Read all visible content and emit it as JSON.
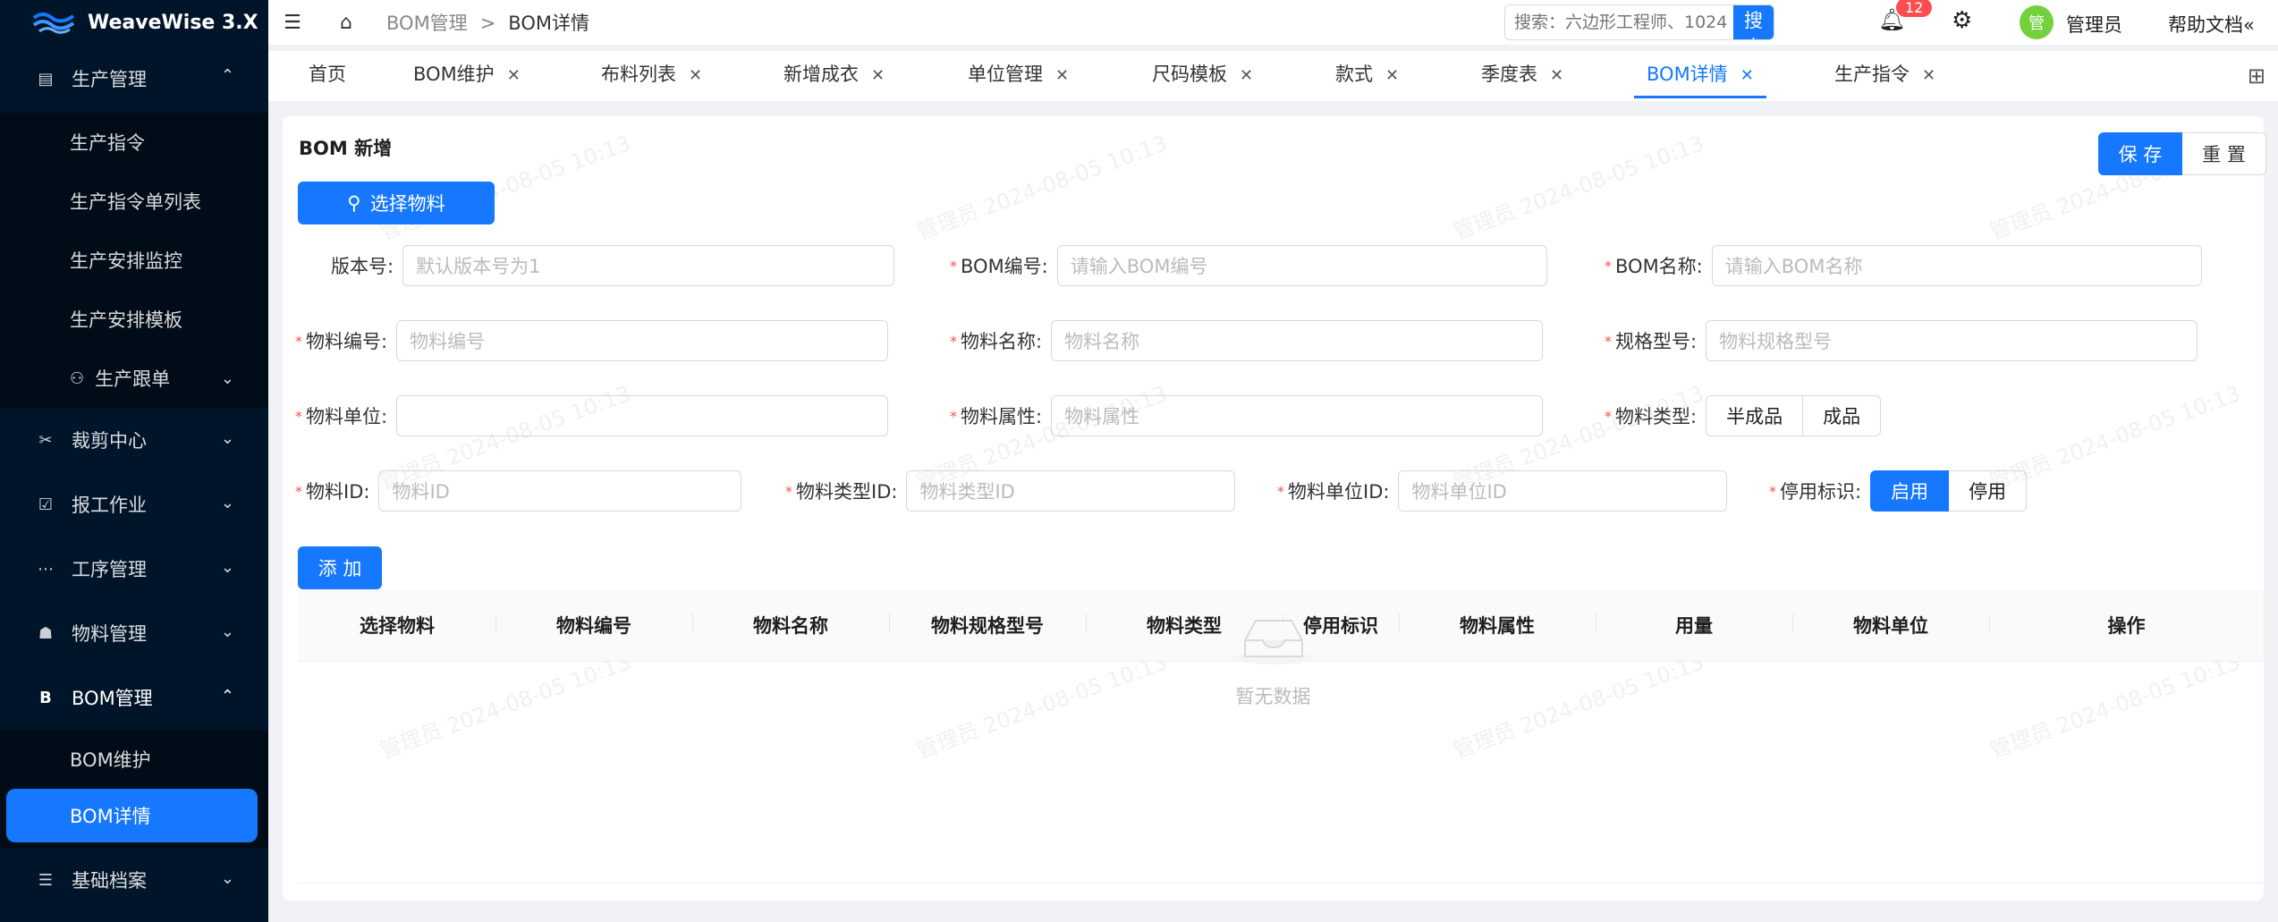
{
  "app": {
    "name": "WeaveWise 3.X"
  },
  "sidebar": {
    "items": [
      {
        "label": "生产管理",
        "icon": "clipboard-icon",
        "expanded": true,
        "children": [
          "生产指令",
          "生产指令单列表",
          "生产安排监控",
          "生产安排模板",
          "生产跟单"
        ]
      },
      {
        "label": "裁剪中心",
        "icon": "scissors-icon"
      },
      {
        "label": "报工作业",
        "icon": "checkbox-icon"
      },
      {
        "label": "工序管理",
        "icon": "dots-icon"
      },
      {
        "label": "物料管理",
        "icon": "hierarchy-icon"
      },
      {
        "label": "BOM管理",
        "icon": "b-letter-icon",
        "expanded": true,
        "children": [
          "BOM维护",
          "BOM详情"
        ]
      },
      {
        "label": "基础档案",
        "icon": "list-icon"
      }
    ],
    "active_child": "BOM详情"
  },
  "header": {
    "breadcrumb": [
      "BOM管理",
      "BOM详情"
    ],
    "breadcrumb_sep": ">",
    "search_placeholder": "搜索：六边形工程师、1024",
    "search_button": "搜 索",
    "notif_count": "12",
    "avatar_text": "管",
    "username": "管理员",
    "help": "帮助文档"
  },
  "tabs": [
    {
      "label": "首页",
      "closable": false
    },
    {
      "label": "BOM维护",
      "closable": true
    },
    {
      "label": "布料列表",
      "closable": true
    },
    {
      "label": "新增成衣",
      "closable": true
    },
    {
      "label": "单位管理",
      "closable": true
    },
    {
      "label": "尺码模板",
      "closable": true
    },
    {
      "label": "款式",
      "closable": true
    },
    {
      "label": "季度表",
      "closable": true
    },
    {
      "label": "BOM详情",
      "closable": true,
      "active": true
    },
    {
      "label": "生产指令",
      "closable": true
    }
  ],
  "form": {
    "title": "BOM 新增",
    "save": "保 存",
    "reset": "重 置",
    "select_material": "选择物料",
    "version": {
      "label": "版本号:",
      "placeholder": "默认版本号为1"
    },
    "bom_code": {
      "label": "BOM编号:",
      "placeholder": "请输入BOM编号"
    },
    "bom_name": {
      "label": "BOM名称:",
      "placeholder": "请输入BOM名称"
    },
    "mat_code": {
      "label": "物料编号:",
      "placeholder": "物料编号"
    },
    "mat_name": {
      "label": "物料名称:",
      "placeholder": "物料名称"
    },
    "spec": {
      "label": "规格型号:",
      "placeholder": "物料规格型号"
    },
    "unit": {
      "label": "物料单位:",
      "placeholder": ""
    },
    "attr": {
      "label": "物料属性:",
      "placeholder": "物料属性"
    },
    "mat_type": {
      "label": "物料类型:",
      "options": [
        "半成品",
        "成品"
      ]
    },
    "mat_id": {
      "label": "物料ID:",
      "placeholder": "物料ID"
    },
    "type_id": {
      "label": "物料类型ID:",
      "placeholder": "物料类型ID"
    },
    "unit_id": {
      "label": "物料单位ID:",
      "placeholder": "物料单位ID"
    },
    "disable": {
      "label": "停用标识:",
      "options": [
        "启用",
        "停用"
      ],
      "selected": "启用"
    },
    "add": "添 加"
  },
  "table": {
    "columns": [
      "选择物料",
      "物料编号",
      "物料名称",
      "物料规格型号",
      "物料类型",
      "停用标识",
      "物料属性",
      "用量",
      "物料单位",
      "操作"
    ],
    "empty": "暂无数据"
  },
  "watermark": "管理员 2024-08-05 10:13",
  "colors": {
    "primary": "#1677ff",
    "sidebar": "#001529",
    "required": "#ff4d4f"
  }
}
